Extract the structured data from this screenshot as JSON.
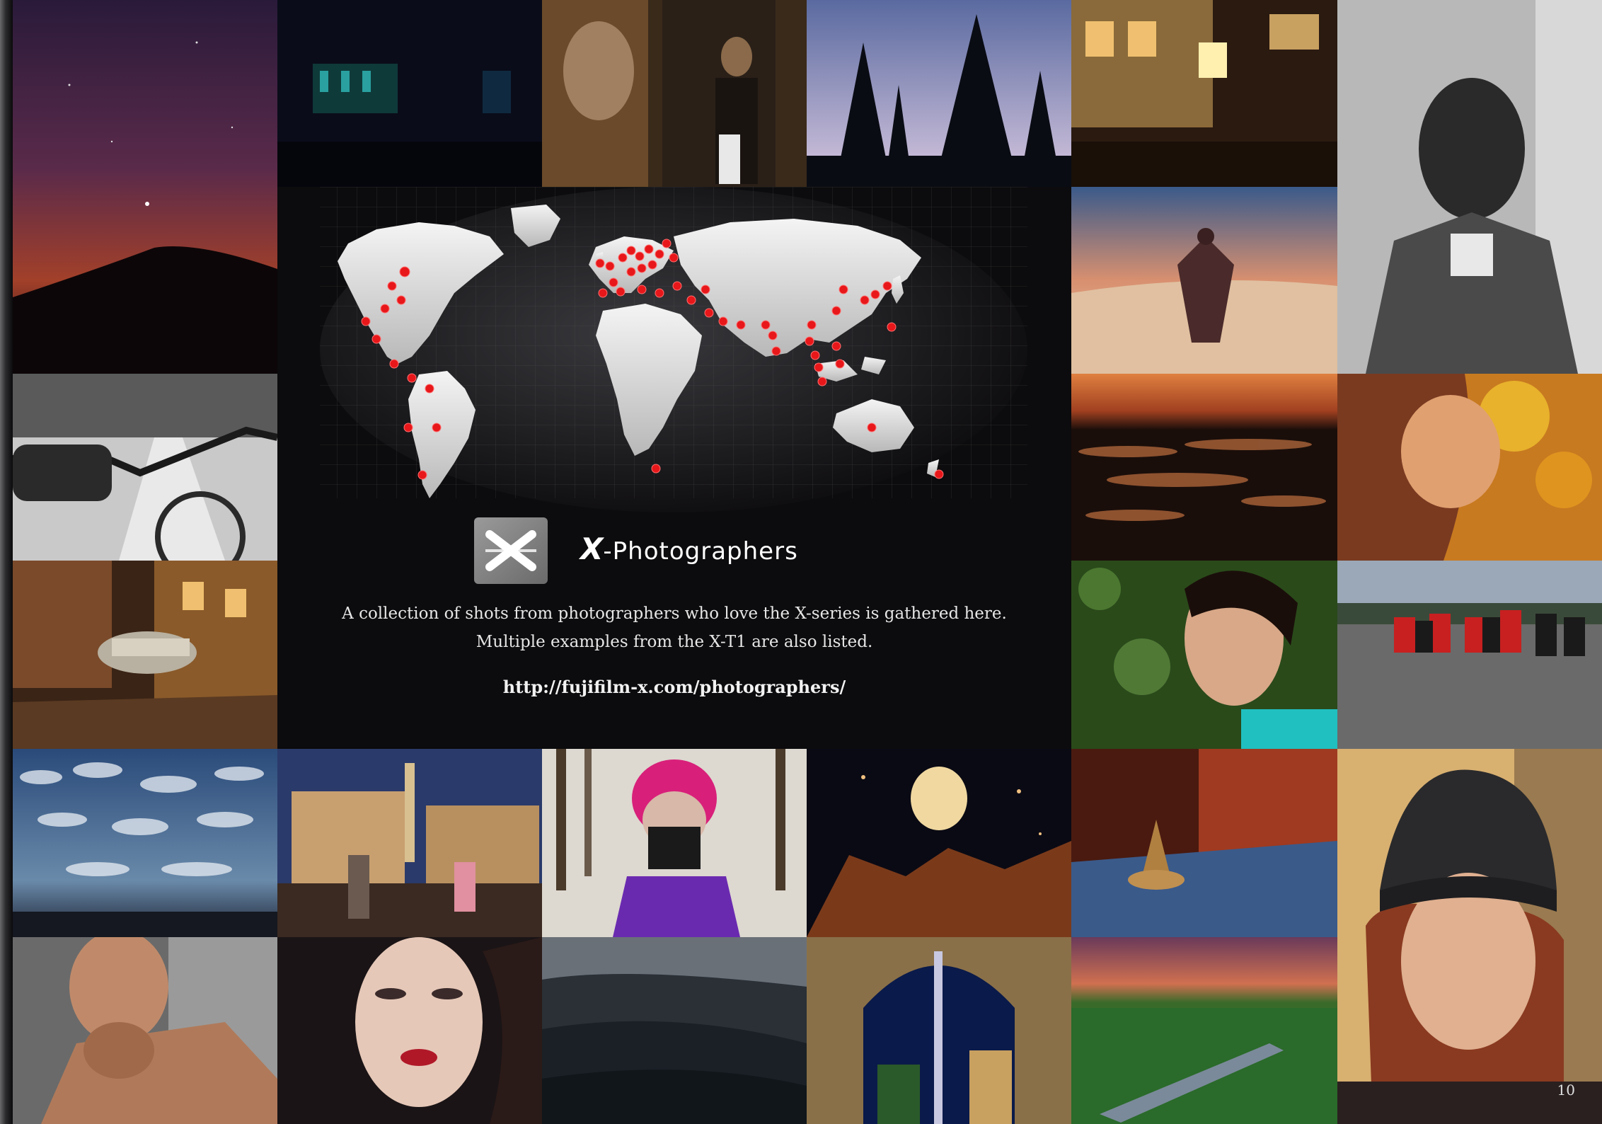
{
  "brand": {
    "logo_icon": "x-logo-icon",
    "name_prefix": "X",
    "name_rest": "-Photographers"
  },
  "description": {
    "line1": "A collection of shots from photographers who love the X-series is gathered here.",
    "line2": "Multiple examples from the X-T1 are also listed."
  },
  "url": "http://fujifilm-x.com/photographers/",
  "page_number": "10",
  "colors": {
    "background": "#0c0b0d",
    "marker": "#e8171a",
    "continent": "#d9d9d9",
    "text": "#e6e6e6"
  }
}
